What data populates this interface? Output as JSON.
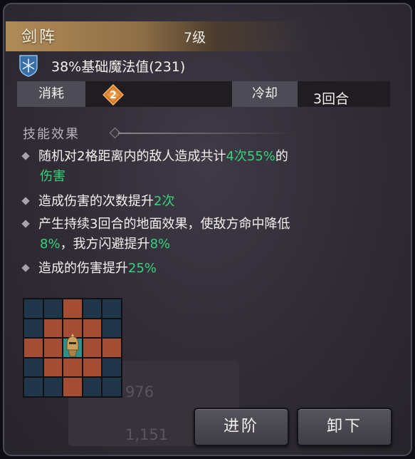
{
  "skill": {
    "name": "剑阵",
    "level": "7级",
    "scaling": "38%基础魔法值(231)"
  },
  "cost": {
    "label": "消耗",
    "value": "2"
  },
  "cooldown": {
    "label": "冷却",
    "value": "3回合"
  },
  "effects_title": "技能效果",
  "effects": [
    {
      "parts": [
        {
          "text": "随机对2格距离内的敌人造成共计",
          "highlight": false
        },
        {
          "text": "4次",
          "highlight": true
        },
        {
          "text": "55%",
          "highlight": true
        },
        {
          "text": "的",
          "highlight": false
        }
      ],
      "continuation": [
        {
          "text": "伤害",
          "highlight": true
        }
      ]
    },
    {
      "parts": [
        {
          "text": "造成伤害的次数提升",
          "highlight": false
        },
        {
          "text": "2次",
          "highlight": true
        }
      ]
    },
    {
      "parts": [
        {
          "text": "产生持续3回合的地面效果，使敌方命中降低",
          "highlight": false
        }
      ],
      "continuation": [
        {
          "text": "8%",
          "highlight": true
        },
        {
          "text": "，我方闪避提升",
          "highlight": false
        },
        {
          "text": "8%",
          "highlight": true
        }
      ]
    },
    {
      "parts": [
        {
          "text": "造成的伤害提升",
          "highlight": false
        },
        {
          "text": "25%",
          "highlight": true
        }
      ]
    }
  ],
  "range_grid": [
    [
      0,
      0,
      1,
      0,
      0
    ],
    [
      0,
      1,
      1,
      1,
      0
    ],
    [
      1,
      1,
      2,
      1,
      1
    ],
    [
      0,
      1,
      1,
      1,
      0
    ],
    [
      0,
      0,
      1,
      0,
      0
    ]
  ],
  "background_stats": {
    "stat1": "976",
    "stat2": "1,151"
  },
  "buttons": {
    "advance": "进阶",
    "unequip": "卸下"
  },
  "colors": {
    "highlight": "#37d27c",
    "title_gold": "#b08b58",
    "grid_hit": "#a34d34",
    "grid_empty": "#22364a",
    "grid_center": "#2f8f8a"
  },
  "icons": {
    "scaling": "snowflake-shield-icon",
    "cost": "orange-diamond-icon",
    "unit": "golden-helmet-icon"
  }
}
